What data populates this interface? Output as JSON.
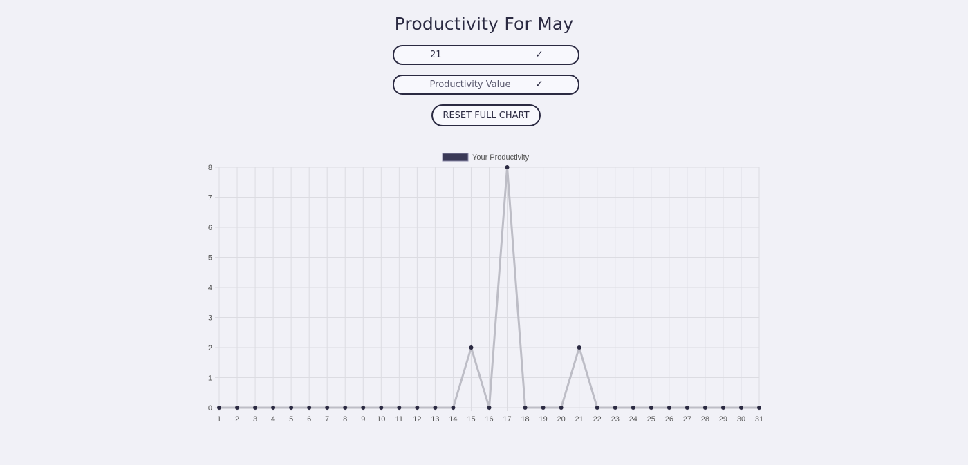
{
  "header": {
    "title": "Productivity For May"
  },
  "form": {
    "day_value": "21",
    "day_check": "✓",
    "value_placeholder": "Productivity Value",
    "value_check": "✓",
    "reset_label": "RESET FULL CHART"
  },
  "colors": {
    "line": "#bdbdc6",
    "point": "#2b2a42",
    "legend_fill": "#3a3956",
    "grid": "#dcdce2"
  },
  "chart_data": {
    "type": "line",
    "legend": [
      "Your Productivity"
    ],
    "legend_position": "top-center",
    "grid": true,
    "x": [
      1,
      2,
      3,
      4,
      5,
      6,
      7,
      8,
      9,
      10,
      11,
      12,
      13,
      14,
      15,
      16,
      17,
      18,
      19,
      20,
      21,
      22,
      23,
      24,
      25,
      26,
      27,
      28,
      29,
      30,
      31
    ],
    "series": [
      {
        "name": "Your Productivity",
        "values": [
          0,
          0,
          0,
          0,
          0,
          0,
          0,
          0,
          0,
          0,
          0,
          0,
          0,
          0,
          2,
          0,
          8,
          0,
          0,
          0,
          2,
          0,
          0,
          0,
          0,
          0,
          0,
          0,
          0,
          0,
          0
        ]
      }
    ],
    "ylim": [
      0,
      8
    ],
    "yticks": [
      0,
      1,
      2,
      3,
      4,
      5,
      6,
      7,
      8
    ]
  }
}
